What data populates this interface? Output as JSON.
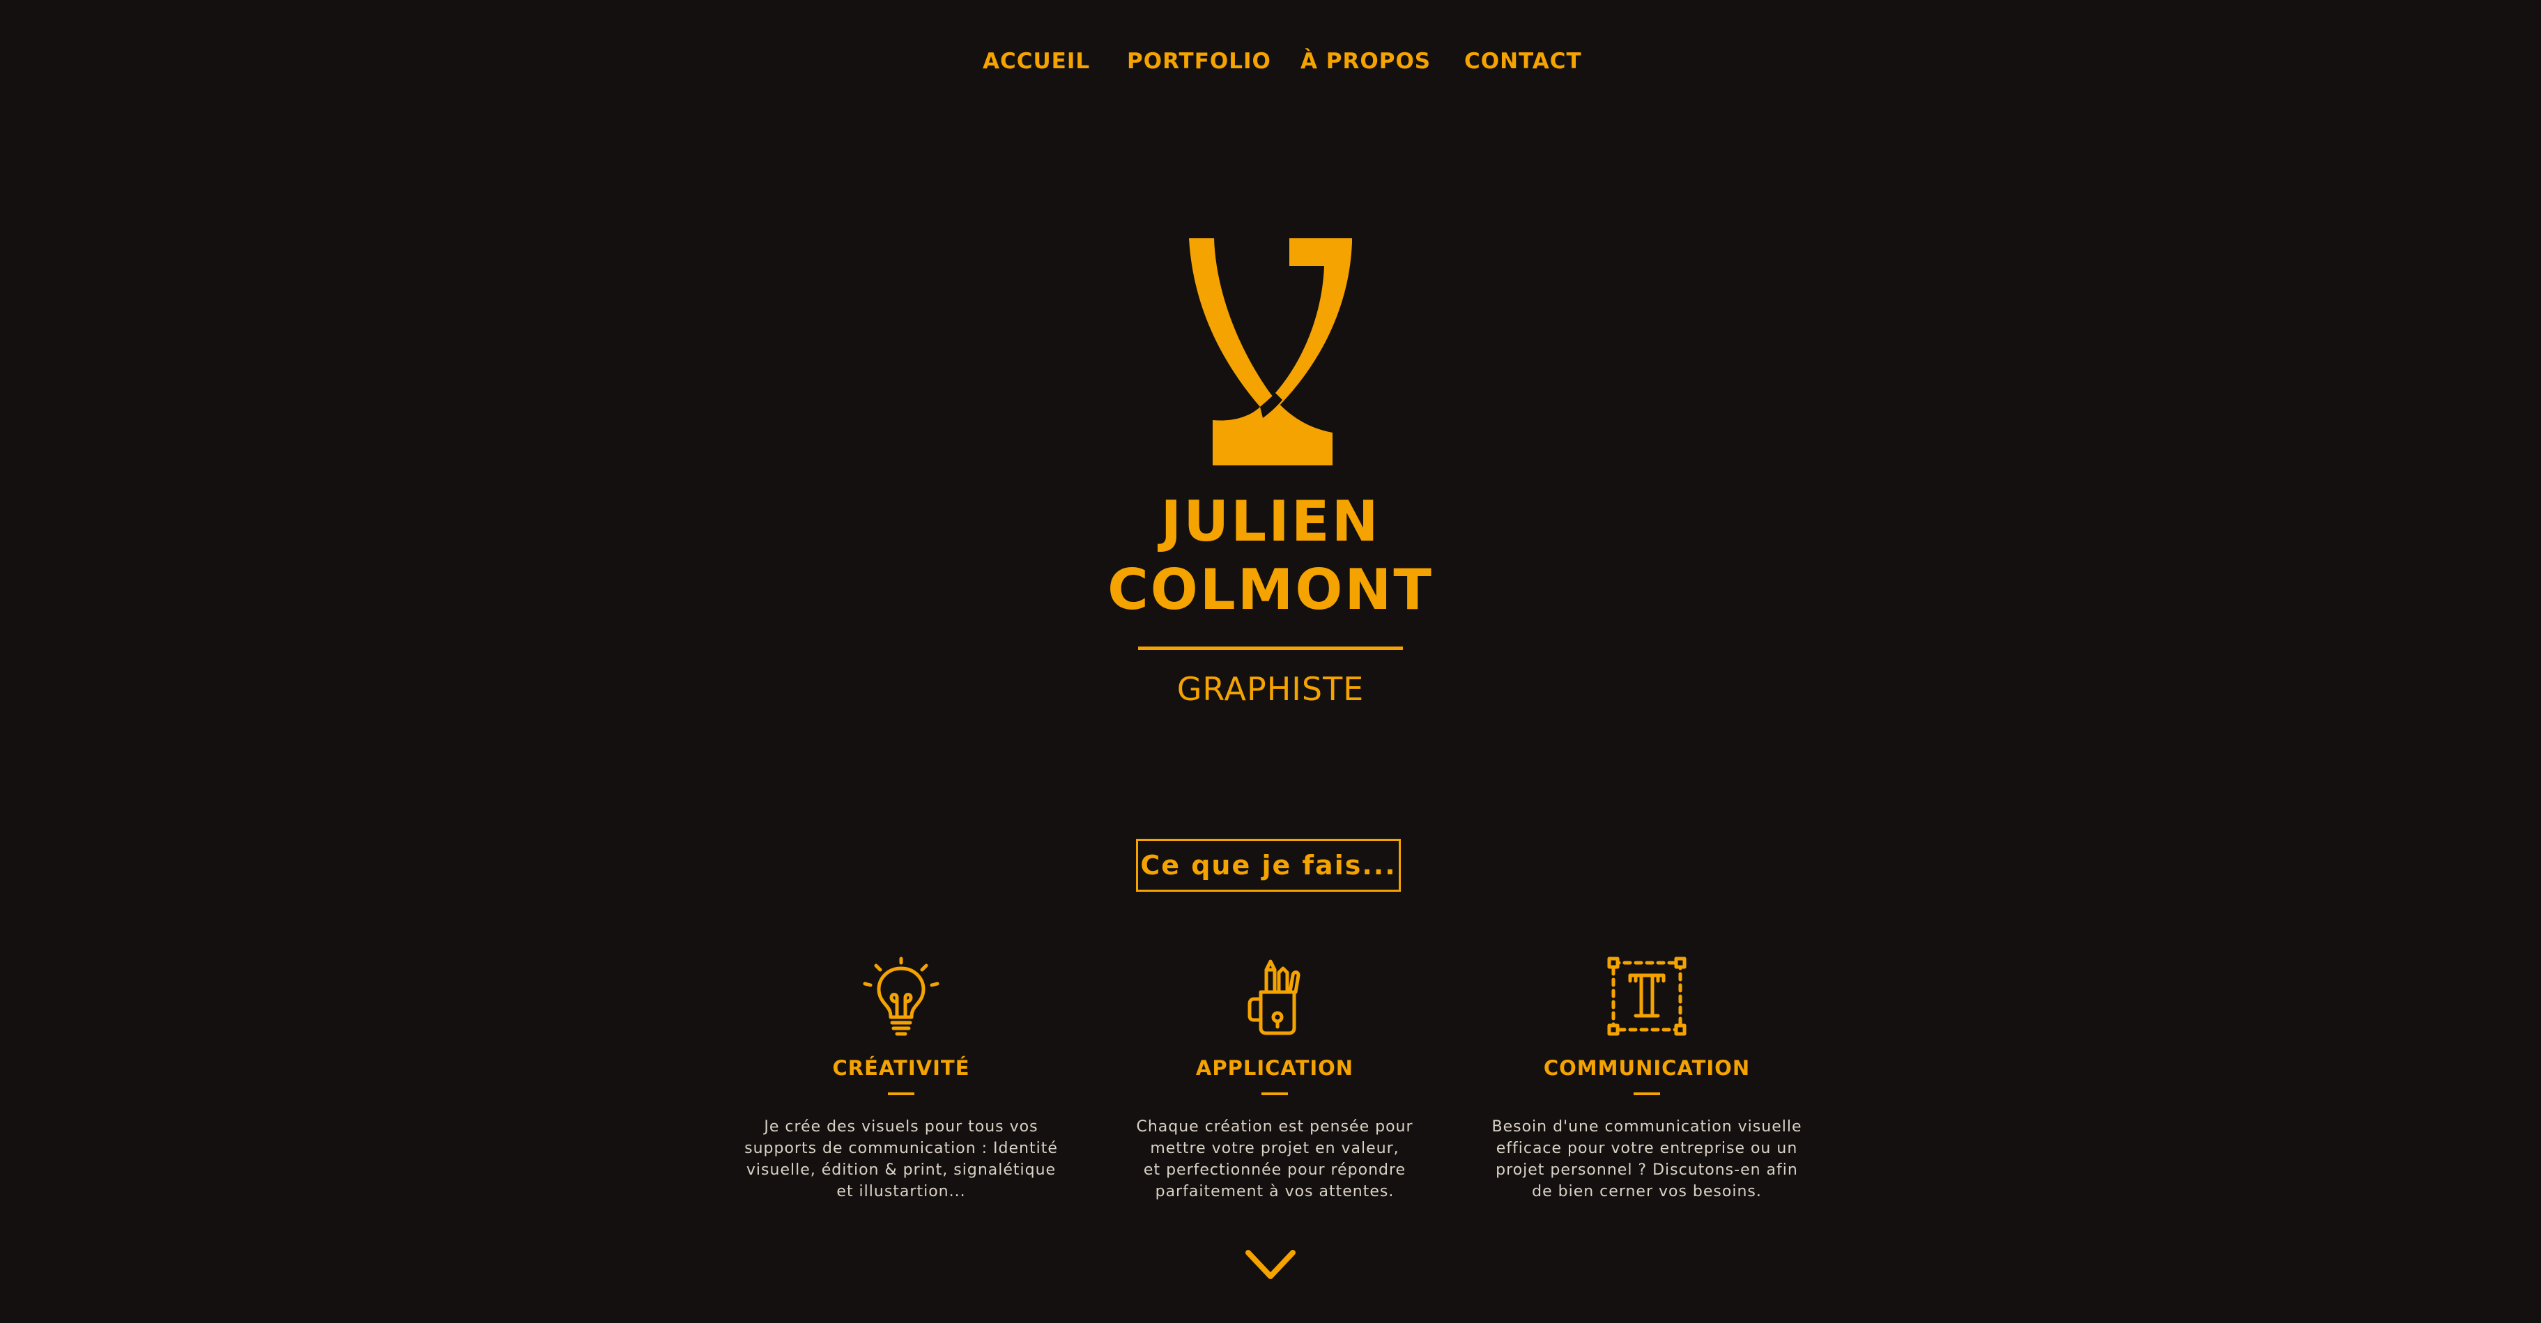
{
  "nav": {
    "items": [
      {
        "label": "ACCUEIL"
      },
      {
        "label": "PORTFOLIO"
      },
      {
        "label": "À PROPOS"
      },
      {
        "label": "CONTACT"
      }
    ]
  },
  "hero": {
    "logo_icon": "jc-monogram-logo",
    "name_line1": "JULIEN",
    "name_line2": "COLMONT",
    "role": "GRAPHISTE"
  },
  "section": {
    "button_label": "Ce que je fais..."
  },
  "features": [
    {
      "icon": "lightbulb-icon",
      "title": "CRÉATIVITÉ",
      "description": "Je crée des visuels pour tous vos\nsupports de communication : Identité\nvisuelle, édition & print, signalétique\net illustartion..."
    },
    {
      "icon": "pencil-cup-icon",
      "title": "APPLICATION",
      "description": "Chaque création est pensée pour\nmettre votre projet en valeur,\net perfectionnée pour répondre\nparfaitement à vos attentes."
    },
    {
      "icon": "text-tool-icon",
      "title": "COMMUNICATION",
      "description": "Besoin d'une communication visuelle\nefficace pour votre entreprise ou un\nprojet personnel ? Discutons-en afin\nde bien cerner vos besoins."
    }
  ],
  "scroll": {
    "icon": "chevron-down-icon"
  },
  "colors": {
    "background": "#141010",
    "accent": "#f5a300",
    "body_text": "#d9d2c5"
  }
}
